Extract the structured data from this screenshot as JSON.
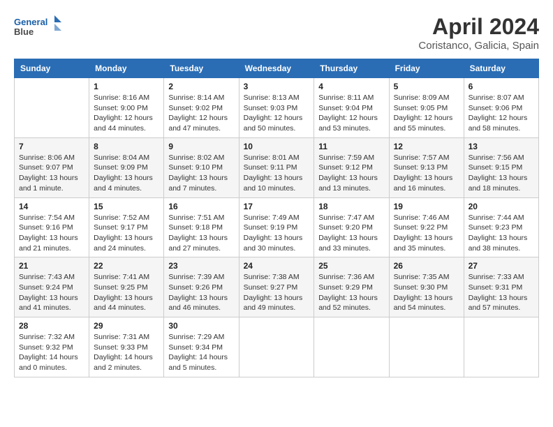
{
  "header": {
    "logo_line1": "General",
    "logo_line2": "Blue",
    "month_title": "April 2024",
    "location": "Coristanco, Galicia, Spain"
  },
  "days_of_week": [
    "Sunday",
    "Monday",
    "Tuesday",
    "Wednesday",
    "Thursday",
    "Friday",
    "Saturday"
  ],
  "weeks": [
    [
      {
        "day": "",
        "info": ""
      },
      {
        "day": "1",
        "info": "Sunrise: 8:16 AM\nSunset: 9:00 PM\nDaylight: 12 hours\nand 44 minutes."
      },
      {
        "day": "2",
        "info": "Sunrise: 8:14 AM\nSunset: 9:02 PM\nDaylight: 12 hours\nand 47 minutes."
      },
      {
        "day": "3",
        "info": "Sunrise: 8:13 AM\nSunset: 9:03 PM\nDaylight: 12 hours\nand 50 minutes."
      },
      {
        "day": "4",
        "info": "Sunrise: 8:11 AM\nSunset: 9:04 PM\nDaylight: 12 hours\nand 53 minutes."
      },
      {
        "day": "5",
        "info": "Sunrise: 8:09 AM\nSunset: 9:05 PM\nDaylight: 12 hours\nand 55 minutes."
      },
      {
        "day": "6",
        "info": "Sunrise: 8:07 AM\nSunset: 9:06 PM\nDaylight: 12 hours\nand 58 minutes."
      }
    ],
    [
      {
        "day": "7",
        "info": "Sunrise: 8:06 AM\nSunset: 9:07 PM\nDaylight: 13 hours\nand 1 minute."
      },
      {
        "day": "8",
        "info": "Sunrise: 8:04 AM\nSunset: 9:09 PM\nDaylight: 13 hours\nand 4 minutes."
      },
      {
        "day": "9",
        "info": "Sunrise: 8:02 AM\nSunset: 9:10 PM\nDaylight: 13 hours\nand 7 minutes."
      },
      {
        "day": "10",
        "info": "Sunrise: 8:01 AM\nSunset: 9:11 PM\nDaylight: 13 hours\nand 10 minutes."
      },
      {
        "day": "11",
        "info": "Sunrise: 7:59 AM\nSunset: 9:12 PM\nDaylight: 13 hours\nand 13 minutes."
      },
      {
        "day": "12",
        "info": "Sunrise: 7:57 AM\nSunset: 9:13 PM\nDaylight: 13 hours\nand 16 minutes."
      },
      {
        "day": "13",
        "info": "Sunrise: 7:56 AM\nSunset: 9:15 PM\nDaylight: 13 hours\nand 18 minutes."
      }
    ],
    [
      {
        "day": "14",
        "info": "Sunrise: 7:54 AM\nSunset: 9:16 PM\nDaylight: 13 hours\nand 21 minutes."
      },
      {
        "day": "15",
        "info": "Sunrise: 7:52 AM\nSunset: 9:17 PM\nDaylight: 13 hours\nand 24 minutes."
      },
      {
        "day": "16",
        "info": "Sunrise: 7:51 AM\nSunset: 9:18 PM\nDaylight: 13 hours\nand 27 minutes."
      },
      {
        "day": "17",
        "info": "Sunrise: 7:49 AM\nSunset: 9:19 PM\nDaylight: 13 hours\nand 30 minutes."
      },
      {
        "day": "18",
        "info": "Sunrise: 7:47 AM\nSunset: 9:20 PM\nDaylight: 13 hours\nand 33 minutes."
      },
      {
        "day": "19",
        "info": "Sunrise: 7:46 AM\nSunset: 9:22 PM\nDaylight: 13 hours\nand 35 minutes."
      },
      {
        "day": "20",
        "info": "Sunrise: 7:44 AM\nSunset: 9:23 PM\nDaylight: 13 hours\nand 38 minutes."
      }
    ],
    [
      {
        "day": "21",
        "info": "Sunrise: 7:43 AM\nSunset: 9:24 PM\nDaylight: 13 hours\nand 41 minutes."
      },
      {
        "day": "22",
        "info": "Sunrise: 7:41 AM\nSunset: 9:25 PM\nDaylight: 13 hours\nand 44 minutes."
      },
      {
        "day": "23",
        "info": "Sunrise: 7:39 AM\nSunset: 9:26 PM\nDaylight: 13 hours\nand 46 minutes."
      },
      {
        "day": "24",
        "info": "Sunrise: 7:38 AM\nSunset: 9:27 PM\nDaylight: 13 hours\nand 49 minutes."
      },
      {
        "day": "25",
        "info": "Sunrise: 7:36 AM\nSunset: 9:29 PM\nDaylight: 13 hours\nand 52 minutes."
      },
      {
        "day": "26",
        "info": "Sunrise: 7:35 AM\nSunset: 9:30 PM\nDaylight: 13 hours\nand 54 minutes."
      },
      {
        "day": "27",
        "info": "Sunrise: 7:33 AM\nSunset: 9:31 PM\nDaylight: 13 hours\nand 57 minutes."
      }
    ],
    [
      {
        "day": "28",
        "info": "Sunrise: 7:32 AM\nSunset: 9:32 PM\nDaylight: 14 hours\nand 0 minutes."
      },
      {
        "day": "29",
        "info": "Sunrise: 7:31 AM\nSunset: 9:33 PM\nDaylight: 14 hours\nand 2 minutes."
      },
      {
        "day": "30",
        "info": "Sunrise: 7:29 AM\nSunset: 9:34 PM\nDaylight: 14 hours\nand 5 minutes."
      },
      {
        "day": "",
        "info": ""
      },
      {
        "day": "",
        "info": ""
      },
      {
        "day": "",
        "info": ""
      },
      {
        "day": "",
        "info": ""
      }
    ]
  ]
}
